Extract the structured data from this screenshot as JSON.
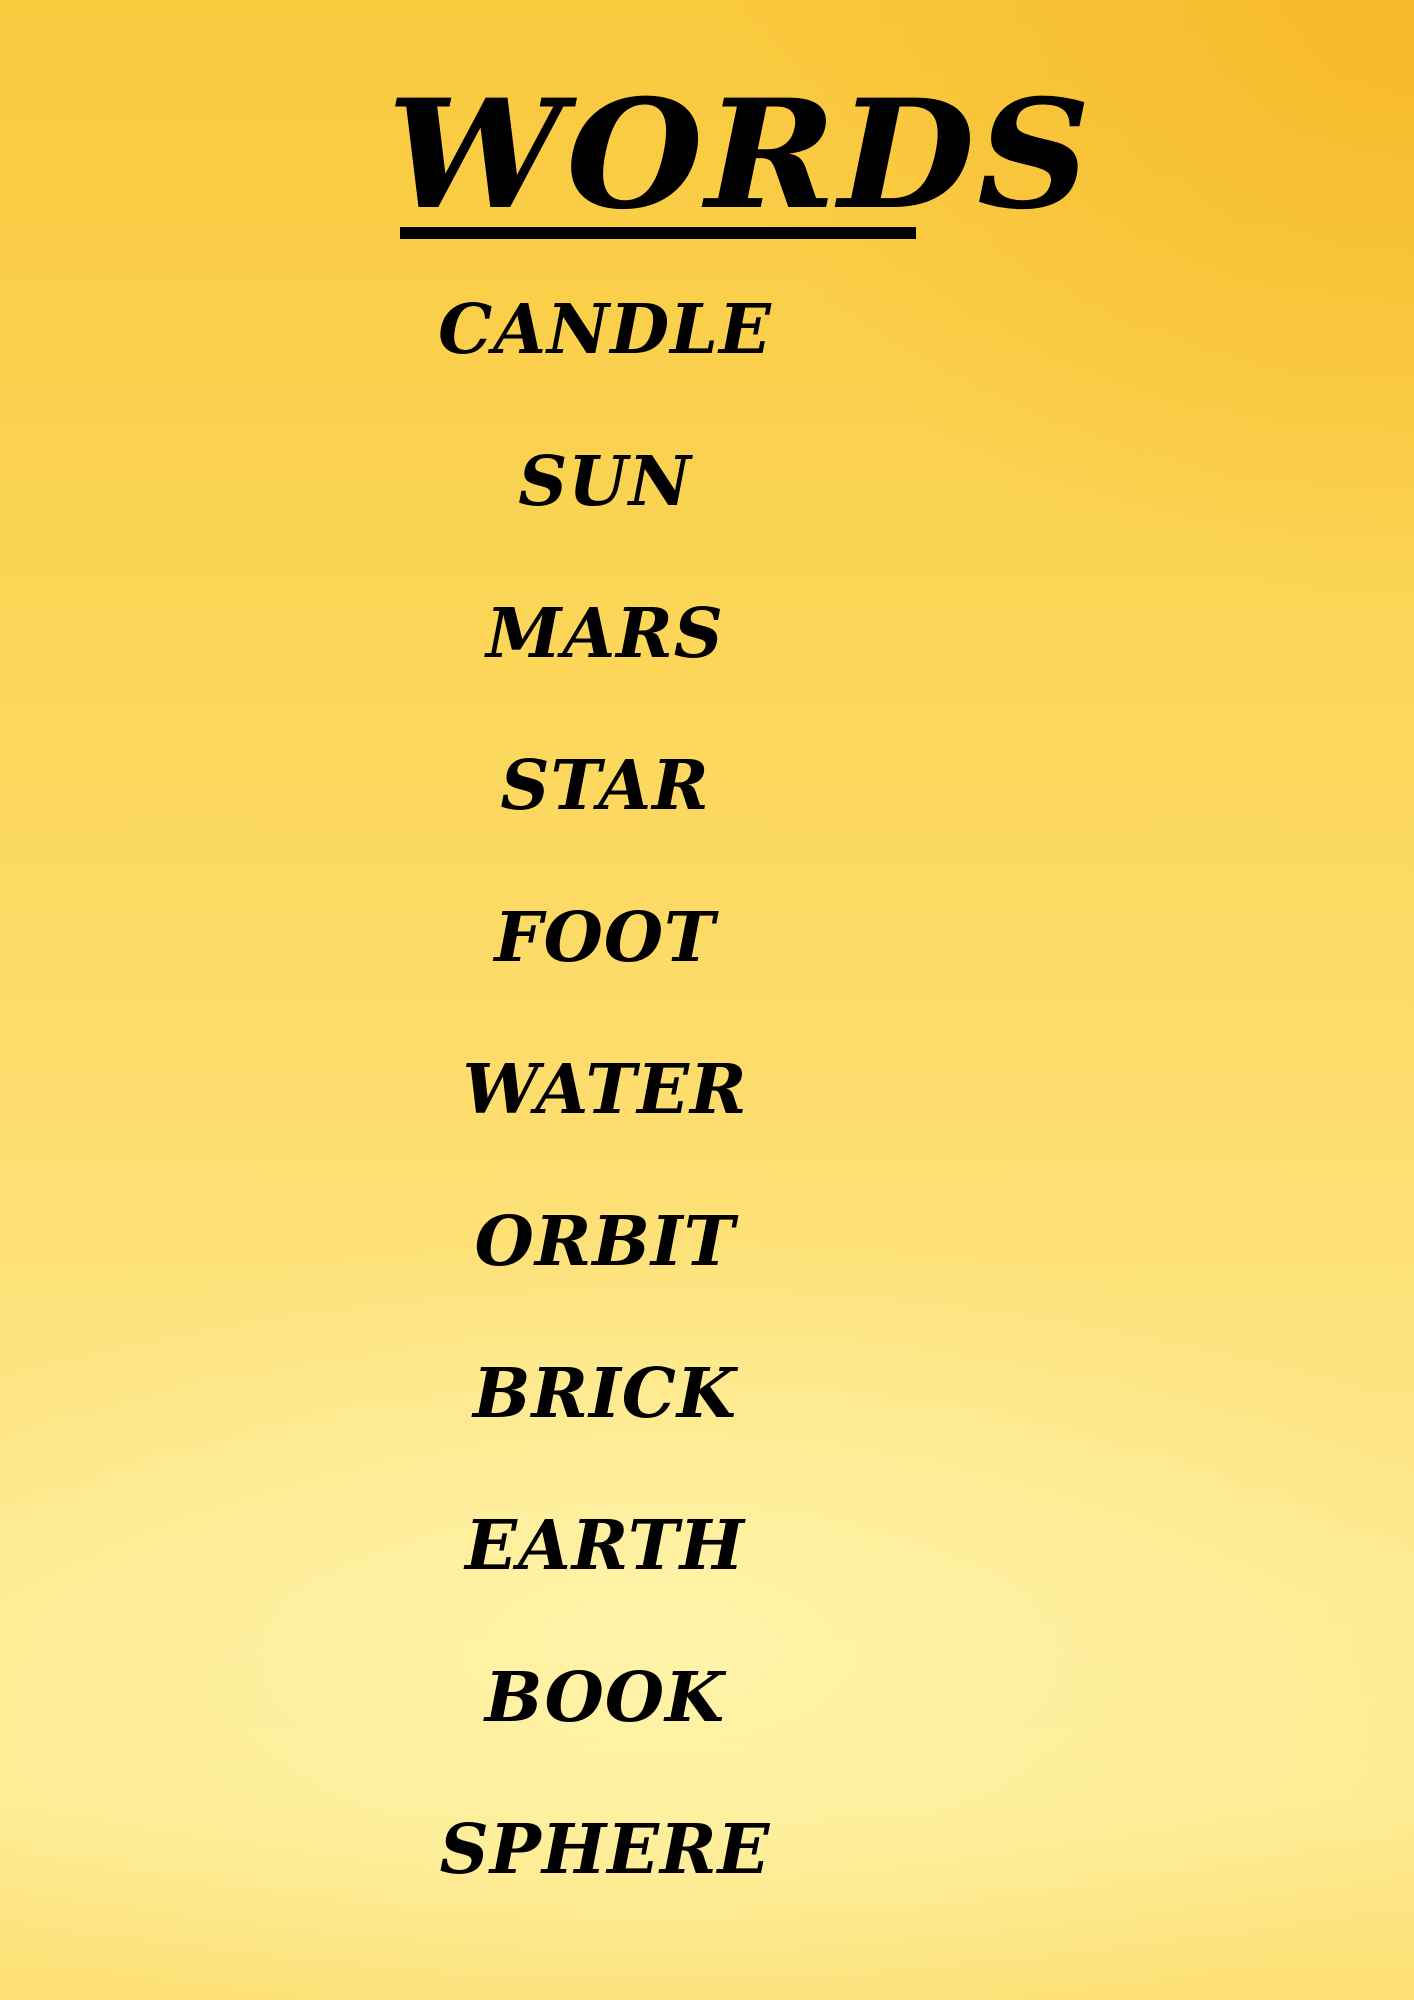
{
  "title": "WORDS",
  "words": [
    "CANDLE",
    "SUN",
    "MARS",
    "STAR",
    "FOOT",
    "WATER",
    "ORBIT",
    "BRICK",
    "EARTH",
    "BOOK",
    "SPHERE"
  ],
  "colors": {
    "text": "#000000",
    "background_top": "#f9c93e",
    "background_light": "#fee98f"
  }
}
